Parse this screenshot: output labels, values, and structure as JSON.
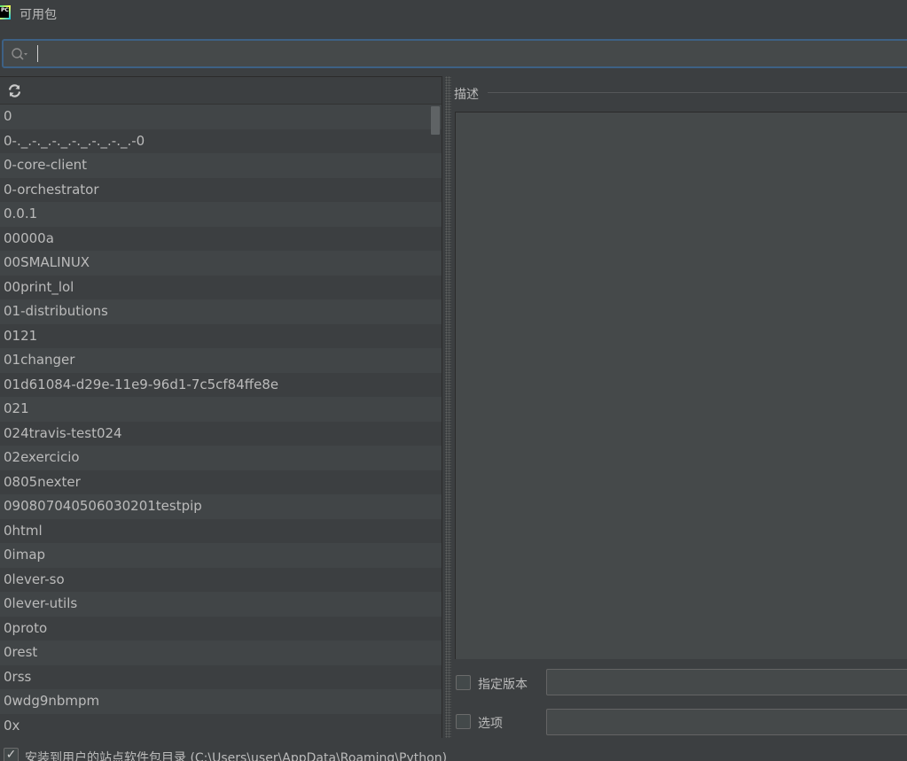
{
  "window": {
    "title": "可用包"
  },
  "search": {
    "placeholder": "",
    "value": ""
  },
  "toolbar": {
    "refresh_icon": "refresh-icon"
  },
  "packages": [
    "0",
    "0-._.-._.-._.-._.-._.-._.-0",
    "0-core-client",
    "0-orchestrator",
    "0.0.1",
    "00000a",
    "00SMALINUX",
    "00print_lol",
    "01-distributions",
    "0121",
    "01changer",
    "01d61084-d29e-11e9-96d1-7c5cf84ffe8e",
    "021",
    "024travis-test024",
    "02exercicio",
    "0805nexter",
    "090807040506030201testpip",
    "0html",
    "0imap",
    "0lever-so",
    "0lever-utils",
    "0proto",
    "0rest",
    "0rss",
    "0wdg9nbmpm",
    "0x"
  ],
  "details": {
    "description_label": "描述"
  },
  "options": {
    "specify_version_label": "指定版本",
    "options_label": "选项",
    "specify_version_checked": false,
    "options_checked": false
  },
  "footer": {
    "install_user_label": "安装到用户的站点软件包目录 (C:\\Users\\user\\AppData\\Roaming\\Python)",
    "install_user_checked": true
  },
  "colors": {
    "background": "#3c3f41",
    "row_alt": "#414547",
    "field": "#45494a",
    "focus_border": "#3d6185",
    "text": "#bbbbbb"
  }
}
